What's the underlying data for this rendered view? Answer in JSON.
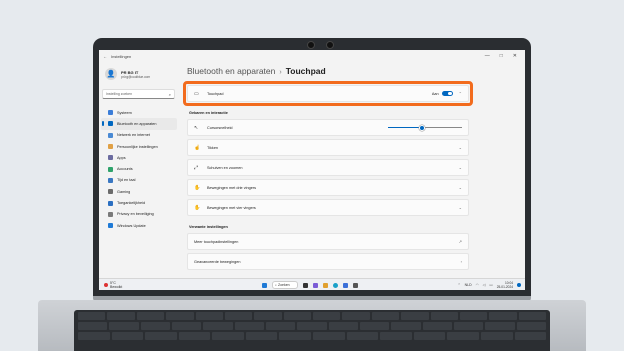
{
  "window": {
    "title": "Instellingen",
    "back_glyph": "←",
    "min": "—",
    "max": "□",
    "close": "✕"
  },
  "user": {
    "name": "PR BG IT",
    "email": "pr.bg@coolblue.com"
  },
  "search": {
    "placeholder": "Instelling zoeken"
  },
  "sidebar": {
    "items": [
      {
        "label": "Systeem",
        "color": "#3b7dd8"
      },
      {
        "label": "Bluetooth en apparaten",
        "color": "#0067c0"
      },
      {
        "label": "Netwerk en internet",
        "color": "#4a8ad4"
      },
      {
        "label": "Persoonlijke instellingen",
        "color": "#e0a045"
      },
      {
        "label": "Apps",
        "color": "#6b6b9f"
      },
      {
        "label": "Accounts",
        "color": "#2fa36b"
      },
      {
        "label": "Tijd en taal",
        "color": "#3a78c2"
      },
      {
        "label": "Gaming",
        "color": "#6b6b6b"
      },
      {
        "label": "Toegankelijkheid",
        "color": "#2b6fc1"
      },
      {
        "label": "Privacy en beveiliging",
        "color": "#7a7a7a"
      },
      {
        "label": "Windows Update",
        "color": "#1f7ad6"
      }
    ],
    "active_index": 1
  },
  "breadcrumb": {
    "parent": "Bluetooth en apparaten",
    "separator": "›",
    "current": "Touchpad"
  },
  "touchpad_card": {
    "label": "Touchpad",
    "state_label": "Aan",
    "toggle_on": true,
    "chevron": "⌃"
  },
  "section1": {
    "title": "Gebaren en interactie"
  },
  "cursor": {
    "label": "Cursorsnelheid",
    "value_fraction": 0.45
  },
  "gesture_rows": [
    {
      "label": "Tikken",
      "icon": "pointer-icon",
      "glyph": "☝",
      "chevron": "⌄"
    },
    {
      "label": "Schuiven en zoomen",
      "icon": "scroll-icon",
      "glyph": "⤢",
      "chevron": "⌄"
    },
    {
      "label": "Bewegingen met drie vingers",
      "icon": "three-finger-icon",
      "glyph": "✋",
      "chevron": "⌄"
    },
    {
      "label": "Bewegingen met vier vingers",
      "icon": "four-finger-icon",
      "glyph": "✋",
      "chevron": "⌄"
    }
  ],
  "section2": {
    "title": "Verwante instellingen"
  },
  "related_rows": [
    {
      "label": "Meer touchpadinstellingen",
      "glyph": "↗"
    },
    {
      "label": "Geavanceerde bewegingen",
      "glyph": "›"
    }
  ],
  "taskbar": {
    "weather_temp": "5°C",
    "weather_text": "Bewolkt",
    "search_label": "Zoeken",
    "lang": "NLD",
    "time": "10:04",
    "date": "25-01-2024",
    "accent": "#0067c0"
  }
}
